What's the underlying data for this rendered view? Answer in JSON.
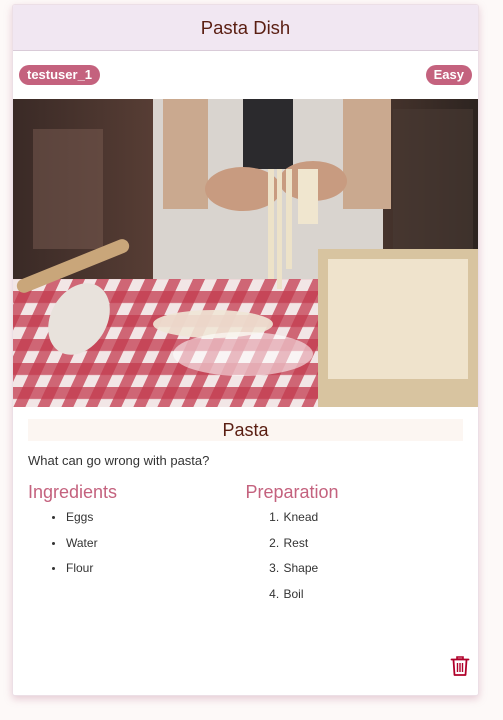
{
  "card": {
    "title": "Pasta Dish",
    "user_badge": "testuser_1",
    "difficulty_badge": "Easy",
    "recipe_name": "Pasta",
    "description": "What can go wrong with pasta?",
    "ingredients_heading": "Ingredients",
    "ingredients": [
      "Eggs",
      "Water",
      "Flour"
    ],
    "preparation_heading": "Preparation",
    "preparation": [
      "Knead",
      "Rest",
      "Shape",
      "Boil"
    ],
    "delete_icon": "trash-icon"
  },
  "colors": {
    "accent": "#c4627e",
    "title_text": "#5a1e12",
    "header_bg": "#f1e7f2",
    "delete_icon": "#b0002a"
  }
}
